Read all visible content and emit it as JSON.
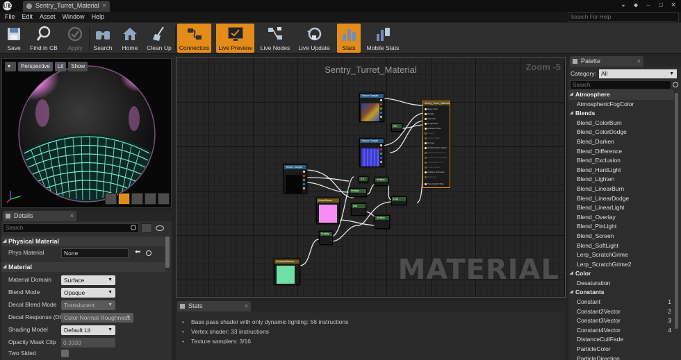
{
  "window": {
    "logo": "UE",
    "tab_title": "Sentry_Turret_Material",
    "tab_close": "×"
  },
  "menu": {
    "items": [
      "File",
      "Edit",
      "Asset",
      "Window",
      "Help"
    ],
    "help_search_placeholder": "Search For Help"
  },
  "toolbar": {
    "buttons": [
      {
        "label": "Save",
        "icon": "save-icon",
        "active": false
      },
      {
        "label": "Find in CB",
        "icon": "find-in-content-browser-icon",
        "active": false
      },
      {
        "label": "Apply",
        "icon": "apply-icon",
        "active": false,
        "disabled": true
      },
      {
        "label": "Search",
        "icon": "search-icon",
        "active": false
      },
      {
        "label": "Home",
        "icon": "home-icon",
        "active": false
      },
      {
        "label": "Clean Up",
        "icon": "clean-up-icon",
        "active": false
      },
      {
        "label": "Connectors",
        "icon": "connectors-icon",
        "active": true
      },
      {
        "label": "Live Preview",
        "icon": "live-preview-icon",
        "active": true
      },
      {
        "label": "Live Nodes",
        "icon": "live-nodes-icon",
        "active": false
      },
      {
        "label": "Live Update",
        "icon": "live-update-icon",
        "active": false
      },
      {
        "label": "Stats",
        "icon": "stats-icon",
        "active": true
      },
      {
        "label": "Mobile Stats",
        "icon": "mobile-stats-icon",
        "active": false
      }
    ],
    "accent_color": "#e48c19"
  },
  "viewport": {
    "perspective_label": "Perspective",
    "lit_label": "Lit",
    "show_label": "Show"
  },
  "details": {
    "tab_label": "Details",
    "search_placeholder": "Search",
    "categories": {
      "physical": "Physical Material",
      "material": "Material"
    },
    "phys_material": {
      "label": "Phys Material",
      "value": "None"
    },
    "rows": [
      {
        "label": "Material Domain",
        "value": "Surface"
      },
      {
        "label": "Blend Mode",
        "value": "Opaque"
      },
      {
        "label": "Decal Blend Mode",
        "value": "Translucent"
      },
      {
        "label": "Decal Response (DI",
        "value": "Color Normal Roughness"
      },
      {
        "label": "Shading Model",
        "value": "Default Lit"
      },
      {
        "label": "Opacity Mask Clip",
        "value": "0.3333"
      },
      {
        "label": "Two Sided",
        "value": ""
      }
    ]
  },
  "graph": {
    "title": "Sentry_Turret_Material",
    "zoom": "Zoom -5",
    "watermark": "MATERIAL"
  },
  "stats": {
    "tab_label": "Stats",
    "lines": [
      "Base pass shader with only dynamic lighting: 56 instructions",
      "Vertex shader: 33 instructions",
      "Texture samplers: 3/16"
    ]
  },
  "palette": {
    "tab_label": "Palette",
    "category_label": "Category:",
    "category_value": "All",
    "search_placeholder": "Search",
    "groups": [
      {
        "name": "Atmosphere",
        "items": [
          {
            "name": "AtmosphericFogColor",
            "hotkey": ""
          }
        ]
      },
      {
        "name": "Blends",
        "items": [
          {
            "name": "Blend_ColorBurn",
            "hotkey": ""
          },
          {
            "name": "Blend_ColorDodge",
            "hotkey": ""
          },
          {
            "name": "Blend_Darken",
            "hotkey": ""
          },
          {
            "name": "Blend_Difference",
            "hotkey": ""
          },
          {
            "name": "Blend_Exclusion",
            "hotkey": ""
          },
          {
            "name": "Blend_HardLight",
            "hotkey": ""
          },
          {
            "name": "Blend_Lighten",
            "hotkey": ""
          },
          {
            "name": "Blend_LinearBurn",
            "hotkey": ""
          },
          {
            "name": "Blend_LinearDodge",
            "hotkey": ""
          },
          {
            "name": "Blend_LinearLight",
            "hotkey": ""
          },
          {
            "name": "Blend_Overlay",
            "hotkey": ""
          },
          {
            "name": "Blend_PinLight",
            "hotkey": ""
          },
          {
            "name": "Blend_Screen",
            "hotkey": ""
          },
          {
            "name": "Blend_SoftLight",
            "hotkey": ""
          },
          {
            "name": "Lerp_ScratchGrime",
            "hotkey": ""
          },
          {
            "name": "Lerp_ScratchGrime2",
            "hotkey": ""
          }
        ]
      },
      {
        "name": "Color",
        "items": [
          {
            "name": "Desaturation",
            "hotkey": ""
          }
        ]
      },
      {
        "name": "Constants",
        "items": [
          {
            "name": "Constant",
            "hotkey": "1"
          },
          {
            "name": "Constant2Vector",
            "hotkey": "2"
          },
          {
            "name": "Constant3Vector",
            "hotkey": "3"
          },
          {
            "name": "Constant4Vector",
            "hotkey": "4"
          },
          {
            "name": "DistanceCullFade",
            "hotkey": ""
          },
          {
            "name": "ParticleColor",
            "hotkey": ""
          },
          {
            "name": "ParticleDirection",
            "hotkey": ""
          }
        ]
      }
    ]
  }
}
